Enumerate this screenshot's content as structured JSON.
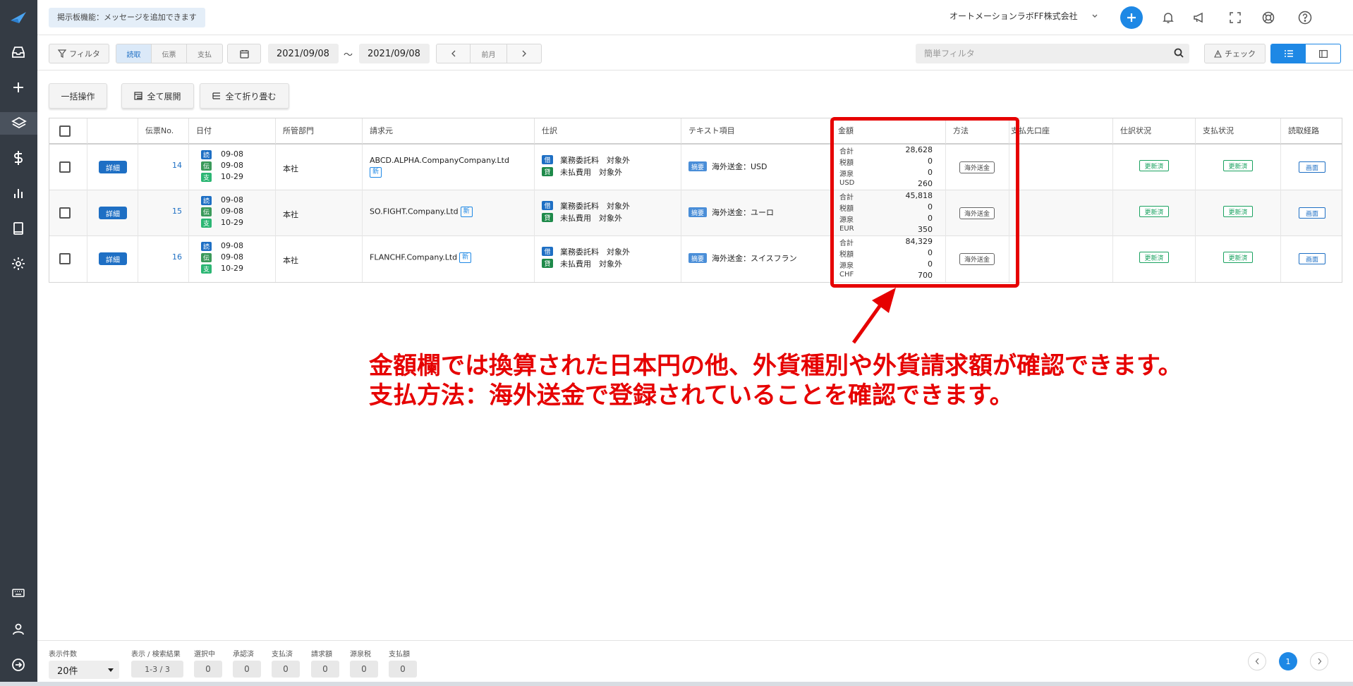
{
  "topbar": {
    "notice": "掲示板機能：メッセージを追加できます",
    "company": "オートメーションラボFF株式会社"
  },
  "toolbar": {
    "filter_label": "フィルタ",
    "segments": [
      "読取",
      "伝票",
      "支払"
    ],
    "active_segment": "読取",
    "date_from": "2021/09/08",
    "date_sep": "〜",
    "date_to": "2021/09/08",
    "pager_label": "前月",
    "search_placeholder": "簡単フィルタ",
    "check_label": "チェック"
  },
  "actions": {
    "bulk": "一括操作",
    "expand_all": "全て展開",
    "collapse_all": "全て折り畳む"
  },
  "table": {
    "headers": [
      "",
      "",
      "伝票No.",
      "日付",
      "所管部門",
      "請求元",
      "仕訳",
      "テキスト項目",
      "金額",
      "方法",
      "支払先口座",
      "仕訳状況",
      "支払状況",
      "読取経路"
    ],
    "detail_label": "詳細",
    "date_badges": [
      "読",
      "伝",
      "支"
    ],
    "new_tag": "新",
    "journal_badges": [
      "借",
      "貸"
    ],
    "text_badge": "摘要",
    "amount_labels": [
      "合計",
      "税額",
      "源泉"
    ],
    "rows": [
      {
        "no": "14",
        "dates": [
          "09-08",
          "09-08",
          "10-29"
        ],
        "dept": "本社",
        "vendor": "ABCD.ALPHA.CompanyCompany.Ltd",
        "journal": [
          "業務委託料　対象外",
          "未払費用　対象外"
        ],
        "text": "海外送金：USD",
        "amounts": [
          "28,628",
          "0",
          "0"
        ],
        "currency": "USD",
        "fx_amount": "260",
        "method": "海外送金",
        "journal_status": "更新済",
        "payment_status": "更新済",
        "route": "画面"
      },
      {
        "no": "15",
        "dates": [
          "09-08",
          "09-08",
          "10-29"
        ],
        "dept": "本社",
        "vendor": "SO.FIGHT.Company.Ltd",
        "journal": [
          "業務委託料　対象外",
          "未払費用　対象外"
        ],
        "text": "海外送金：ユーロ",
        "amounts": [
          "45,818",
          "0",
          "0"
        ],
        "currency": "EUR",
        "fx_amount": "350",
        "method": "海外送金",
        "journal_status": "更新済",
        "payment_status": "更新済",
        "route": "画面"
      },
      {
        "no": "16",
        "dates": [
          "09-08",
          "09-08",
          "10-29"
        ],
        "dept": "本社",
        "vendor": "FLANCHF.Company.Ltd",
        "journal": [
          "業務委託料　対象外",
          "未払費用　対象外"
        ],
        "text": "海外送金：スイスフラン",
        "amounts": [
          "84,329",
          "0",
          "0"
        ],
        "currency": "CHF",
        "fx_amount": "700",
        "method": "海外送金",
        "journal_status": "更新済",
        "payment_status": "更新済",
        "route": "画面"
      }
    ]
  },
  "annotation": {
    "line1": "金額欄では換算された日本円の他、外貨種別や外貨請求額が確認できます。",
    "line2": "支払方法：海外送金で登録されていることを確認できます。"
  },
  "footer": {
    "per_page_label": "表示件数",
    "per_page_value": "20件",
    "result_label": "表示 / 検索結果",
    "result_value": "1-3 / 3",
    "stats": [
      {
        "label": "選択中",
        "value": "0"
      },
      {
        "label": "承認済",
        "value": "0"
      },
      {
        "label": "支払済",
        "value": "0"
      },
      {
        "label": "請求額",
        "value": "0"
      },
      {
        "label": "源泉税",
        "value": "0"
      },
      {
        "label": "支払額",
        "value": "0"
      }
    ],
    "current_page": "1"
  },
  "colors": {
    "sidebar": "#343b44",
    "primary": "#1e88e5",
    "highlight": "#e60000",
    "success": "#1aa260"
  }
}
